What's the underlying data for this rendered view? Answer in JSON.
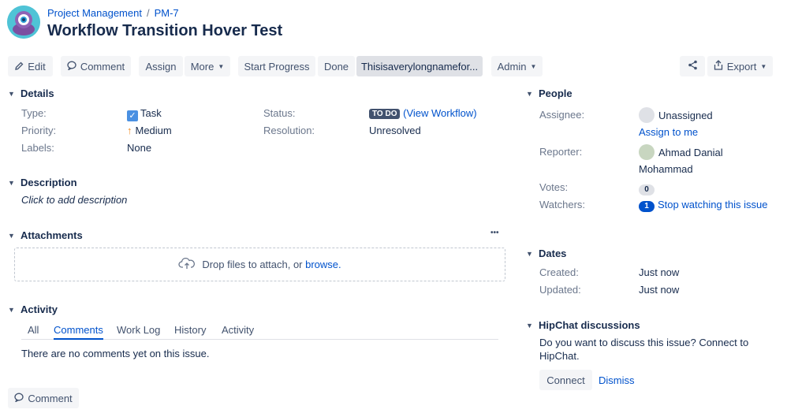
{
  "breadcrumb": {
    "project": "Project Management",
    "separator": "/",
    "issue_key": "PM-7"
  },
  "title": "Workflow Transition Hover Test",
  "toolbar": {
    "edit": "Edit",
    "comment": "Comment",
    "assign": "Assign",
    "more": "More",
    "start_progress": "Start Progress",
    "done": "Done",
    "long_transition": "Thisisaverylongnamefor...",
    "admin": "Admin",
    "export": "Export"
  },
  "details": {
    "heading": "Details",
    "type_label": "Type:",
    "type_value": "Task",
    "priority_label": "Priority:",
    "priority_value": "Medium",
    "labels_label": "Labels:",
    "labels_value": "None",
    "status_label": "Status:",
    "status_badge": "TO DO",
    "view_workflow": "(View Workflow)",
    "resolution_label": "Resolution:",
    "resolution_value": "Unresolved"
  },
  "description": {
    "heading": "Description",
    "placeholder": "Click to add description"
  },
  "attachments": {
    "heading": "Attachments",
    "more": "•••",
    "drop_text": "Drop files to attach, or ",
    "browse": "browse."
  },
  "activity": {
    "heading": "Activity",
    "tabs": [
      "All",
      "Comments",
      "Work Log",
      "History",
      "Activity"
    ],
    "active_tab": "Comments",
    "empty": "There are no comments yet on this issue.",
    "comment_button": "Comment"
  },
  "people": {
    "heading": "People",
    "assignee_label": "Assignee:",
    "assignee_value": "Unassigned",
    "assign_to_me": "Assign to me",
    "reporter_label": "Reporter:",
    "reporter_value_line1": "Ahmad Danial",
    "reporter_value_line2": "Mohammad",
    "votes_label": "Votes:",
    "votes_count": "0",
    "watchers_label": "Watchers:",
    "watchers_count": "1",
    "stop_watching": "Stop watching this issue"
  },
  "dates": {
    "heading": "Dates",
    "created_label": "Created:",
    "created_value": "Just now",
    "updated_label": "Updated:",
    "updated_value": "Just now"
  },
  "hipchat": {
    "heading": "HipChat discussions",
    "text_line1": "Do you want to discuss this issue? Connect to",
    "text_line2": "HipChat.",
    "connect": "Connect",
    "dismiss": "Dismiss"
  },
  "colors": {
    "link": "#0052cc",
    "text": "#172b4d",
    "label": "#6b778c",
    "button_bg": "#f4f5f7"
  }
}
